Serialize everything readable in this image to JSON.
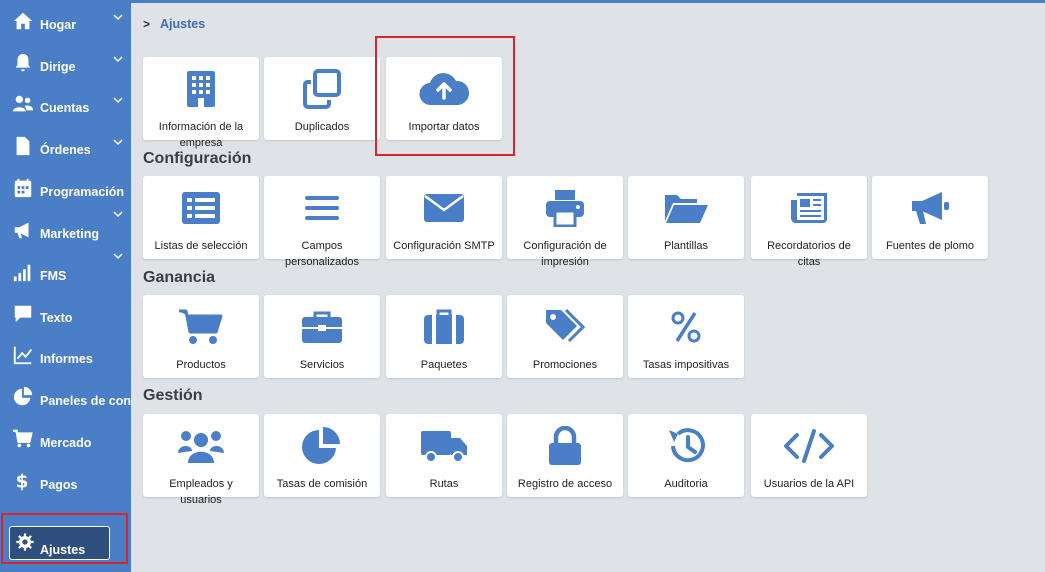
{
  "sidebar": {
    "items": [
      {
        "label": "Hogar",
        "icon": "home-icon",
        "expandable": true
      },
      {
        "label": "Dirige",
        "icon": "bell-icon",
        "expandable": true
      },
      {
        "label": "Cuentas",
        "icon": "users-icon",
        "expandable": true
      },
      {
        "label": "Órdenes",
        "icon": "document-icon",
        "expandable": true
      },
      {
        "label": "Programación",
        "icon": "calendar-icon",
        "expandable": true
      },
      {
        "label": "Marketing",
        "icon": "megaphone-icon",
        "expandable": true
      },
      {
        "label": "FMS",
        "icon": "signal-icon",
        "expandable": false
      },
      {
        "label": "Texto",
        "icon": "chat-icon",
        "expandable": false
      },
      {
        "label": "Informes",
        "icon": "chart-line-icon",
        "expandable": false
      },
      {
        "label": "Paneles de contr",
        "icon": "pie-chart-icon",
        "expandable": false
      },
      {
        "label": "Mercado",
        "icon": "cart-icon",
        "expandable": false
      },
      {
        "label": "Pagos",
        "icon": "dollar-icon",
        "expandable": false
      }
    ],
    "active": {
      "label": "Ajustes",
      "icon": "gear-icon"
    }
  },
  "breadcrumb": {
    "separator": ">",
    "current": "Ajustes"
  },
  "top_cards": [
    {
      "label": "Información de la empresa",
      "icon": "building-icon"
    },
    {
      "label": "Duplicados",
      "icon": "clone-icon"
    },
    {
      "label": "Importar datos",
      "icon": "cloud-upload-icon"
    }
  ],
  "sections": {
    "configuracion": {
      "title": "Configuración",
      "cards": [
        {
          "label": "Listas de selección",
          "icon": "list-icon"
        },
        {
          "label": "Campos personalizados",
          "icon": "bars-icon"
        },
        {
          "label": "Configuración SMTP",
          "icon": "envelope-icon"
        },
        {
          "label": "Configuración de impresión",
          "icon": "printer-icon"
        },
        {
          "label": "Plantillas",
          "icon": "folder-open-icon"
        },
        {
          "label": "Recordatorios de citas",
          "icon": "newspaper-icon"
        },
        {
          "label": "Fuentes de plomo",
          "icon": "bullhorn-icon"
        }
      ]
    },
    "ganancia": {
      "title": "Ganancia",
      "cards": [
        {
          "label": "Productos",
          "icon": "cart-icon"
        },
        {
          "label": "Servicios",
          "icon": "briefcase-icon"
        },
        {
          "label": "Paquetes",
          "icon": "suitcase-icon"
        },
        {
          "label": "Promociones",
          "icon": "tags-icon"
        },
        {
          "label": "Tasas impositivas",
          "icon": "percent-icon"
        }
      ]
    },
    "gestion": {
      "title": "Gestión",
      "cards": [
        {
          "label": "Empleados y usuarios",
          "icon": "users-icon"
        },
        {
          "label": "Tasas de comisión",
          "icon": "pie-chart-icon"
        },
        {
          "label": "Rutas",
          "icon": "truck-icon"
        },
        {
          "label": "Registro de acceso",
          "icon": "lock-icon"
        },
        {
          "label": "Auditoria",
          "icon": "history-icon"
        },
        {
          "label": "Usuarios de la API",
          "icon": "code-icon"
        }
      ]
    }
  },
  "colors": {
    "sidebar": "#4a7ec7",
    "accent_icon": "#4a7ec7",
    "highlight": "#d9242b",
    "background": "#dfe2e6"
  }
}
